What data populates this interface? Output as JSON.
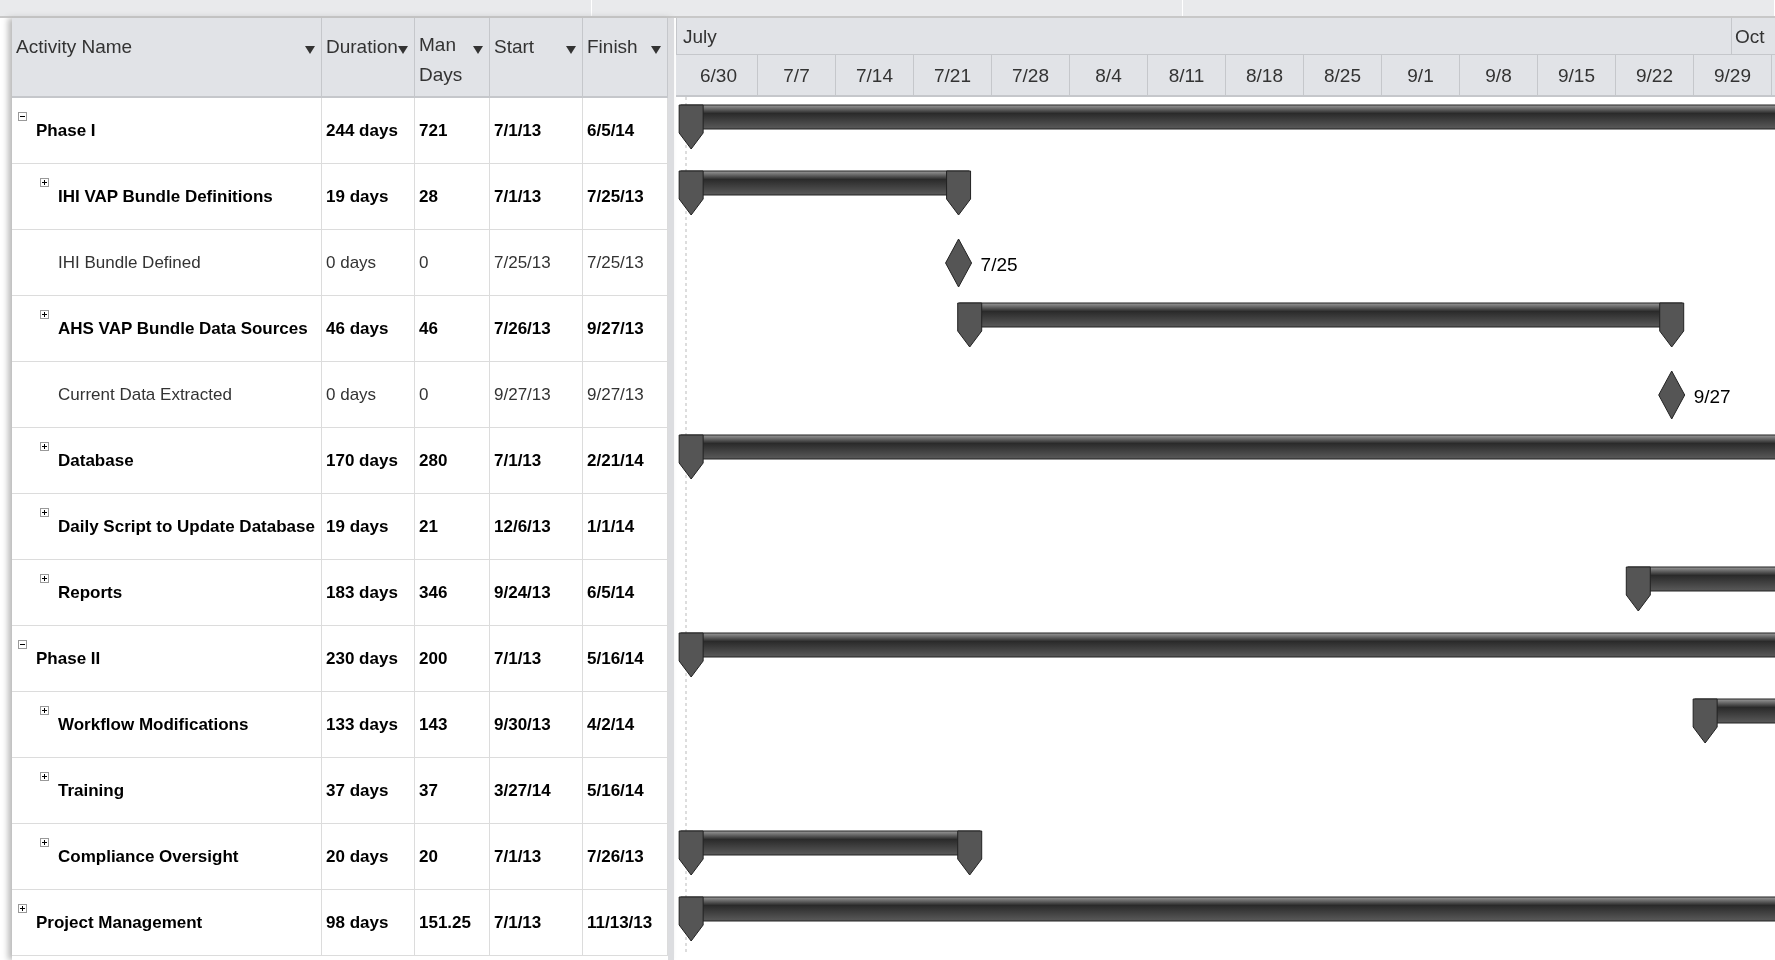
{
  "columns": [
    "Activity Name",
    "Duration",
    "Man Days",
    "Start",
    "Finish"
  ],
  "timescale": {
    "months": [
      "July",
      "Oct"
    ],
    "weeks": [
      "6/30",
      "7/7",
      "7/14",
      "7/21",
      "7/28",
      "8/4",
      "8/11",
      "8/18",
      "8/25",
      "9/1",
      "9/8",
      "9/15",
      "9/22",
      "9/29"
    ]
  },
  "rows": [
    {
      "name": "Phase I",
      "kind": "bar",
      "expanded": true,
      "duration": "244 days",
      "man_days": "721",
      "start": "7/1/13",
      "finish": "6/5/14",
      "children": [
        {
          "name": "IHI VAP Bundle Definitions",
          "kind": "bar",
          "expanded": false,
          "duration": "19 days",
          "man_days": "28",
          "start": "7/1/13",
          "finish": "7/25/13"
        },
        {
          "name": "IHI Bundle Defined",
          "kind": "milestone",
          "milestone_label": "7/25",
          "duration": "0 days",
          "man_days": "0",
          "start": "7/25/13",
          "finish": "7/25/13"
        },
        {
          "name": "AHS VAP Bundle Data Sources",
          "kind": "bar",
          "expanded": false,
          "duration": "46 days",
          "man_days": "46",
          "start": "7/26/13",
          "finish": "9/27/13"
        },
        {
          "name": "Current Data Extracted",
          "kind": "milestone",
          "milestone_label": "9/27",
          "duration": "0 days",
          "man_days": "0",
          "start": "9/27/13",
          "finish": "9/27/13"
        },
        {
          "name": "Database",
          "kind": "bar",
          "expanded": false,
          "duration": "170 days",
          "man_days": "280",
          "start": "7/1/13",
          "finish": "2/21/14"
        },
        {
          "name": "Daily Script to Update Database",
          "kind": "bar",
          "expanded": false,
          "duration": "19 days",
          "man_days": "21",
          "start": "12/6/13",
          "finish": "1/1/14"
        },
        {
          "name": "Reports",
          "kind": "bar",
          "expanded": false,
          "duration": "183 days",
          "man_days": "346",
          "start": "9/24/13",
          "finish": "6/5/14"
        }
      ]
    },
    {
      "name": "Phase II",
      "kind": "bar",
      "expanded": true,
      "duration": "230 days",
      "man_days": "200",
      "start": "7/1/13",
      "finish": "5/16/14",
      "children": [
        {
          "name": "Workflow Modifications",
          "kind": "bar",
          "expanded": false,
          "duration": "133 days",
          "man_days": "143",
          "start": "9/30/13",
          "finish": "4/2/14"
        },
        {
          "name": "Training",
          "kind": "bar",
          "expanded": false,
          "duration": "37 days",
          "man_days": "37",
          "start": "3/27/14",
          "finish": "5/16/14"
        },
        {
          "name": "Compliance Oversight",
          "kind": "bar",
          "expanded": false,
          "duration": "20 days",
          "man_days": "20",
          "start": "7/1/13",
          "finish": "7/26/13"
        }
      ]
    },
    {
      "name": "Project Management",
      "kind": "bar",
      "expanded": false,
      "duration": "98 days",
      "man_days": "151.25",
      "start": "7/1/13",
      "finish": "11/13/13"
    }
  ]
}
